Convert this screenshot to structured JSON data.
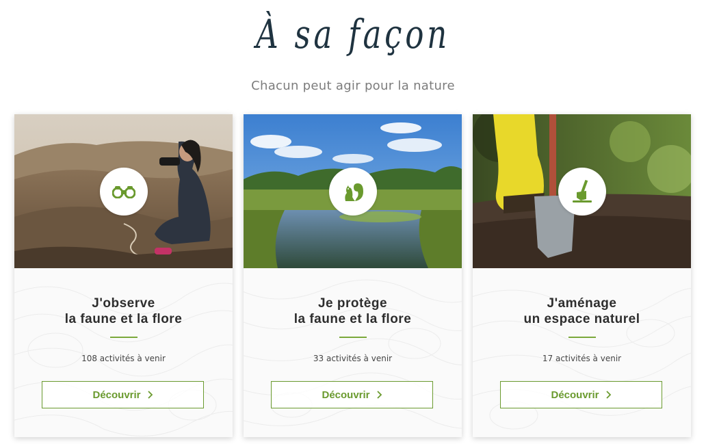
{
  "header": {
    "title": "À sa façon",
    "subtitle": "Chacun peut agir pour la nature"
  },
  "accent_color": "#6a9a2e",
  "cards": [
    {
      "icon": "binoculars-icon",
      "title_line1": "J'observe",
      "title_line2": "la faune et la flore",
      "count": "108 activités à venir",
      "button_label": "Découvrir"
    },
    {
      "icon": "squirrel-icon",
      "title_line1": "Je protège",
      "title_line2": "la faune et la flore",
      "count": "33 activités à venir",
      "button_label": "Découvrir"
    },
    {
      "icon": "shovel-icon",
      "title_line1": "J'aménage",
      "title_line2": "un espace naturel",
      "count": "17 activités à venir",
      "button_label": "Découvrir"
    }
  ]
}
